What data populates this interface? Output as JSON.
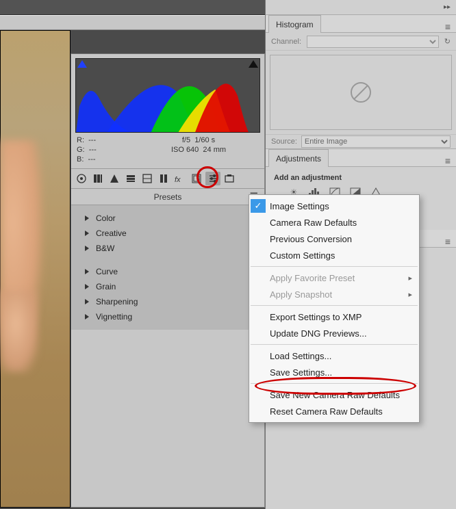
{
  "histogram": {
    "readout": {
      "r_label": "R:",
      "r_val": "---",
      "g_label": "G:",
      "g_val": "---",
      "b_label": "B:",
      "b_val": "---",
      "aperture": "f/5",
      "shutter": "1/60 s",
      "iso": "ISO 640",
      "focal": "24 mm"
    }
  },
  "tabs": [
    {
      "name": "basic-icon"
    },
    {
      "name": "tone-curve-icon"
    },
    {
      "name": "detail-icon"
    },
    {
      "name": "hsl-icon"
    },
    {
      "name": "split-tone-icon"
    },
    {
      "name": "lens-icon"
    },
    {
      "name": "fx-icon"
    },
    {
      "name": "calibrate-icon"
    },
    {
      "name": "presets-icon",
      "active": true
    },
    {
      "name": "snapshots-icon"
    }
  ],
  "presets": {
    "title": "Presets",
    "groups": [
      "Color",
      "Creative",
      "B&W"
    ],
    "groups2": [
      "Curve",
      "Grain",
      "Sharpening",
      "Vignetting"
    ]
  },
  "context_menu": {
    "checked": "Image Settings",
    "items_top": [
      "Image Settings",
      "Camera Raw Defaults",
      "Previous Conversion",
      "Custom Settings"
    ],
    "items_mid": [
      "Apply Favorite Preset",
      "Apply Snapshot"
    ],
    "items_exp": [
      "Export Settings to XMP",
      "Update DNG Previews..."
    ],
    "items_load": [
      "Load Settings...",
      "Save Settings..."
    ],
    "items_def": [
      "Save New Camera Raw Defaults",
      "Reset Camera Raw Defaults"
    ]
  },
  "ps": {
    "hist_tab": "Histogram",
    "channel_label": "Channel:",
    "source_label": "Source:",
    "source_value": "Entire Image",
    "adj_tab": "Adjustments",
    "adj_title": "Add an adjustment"
  }
}
